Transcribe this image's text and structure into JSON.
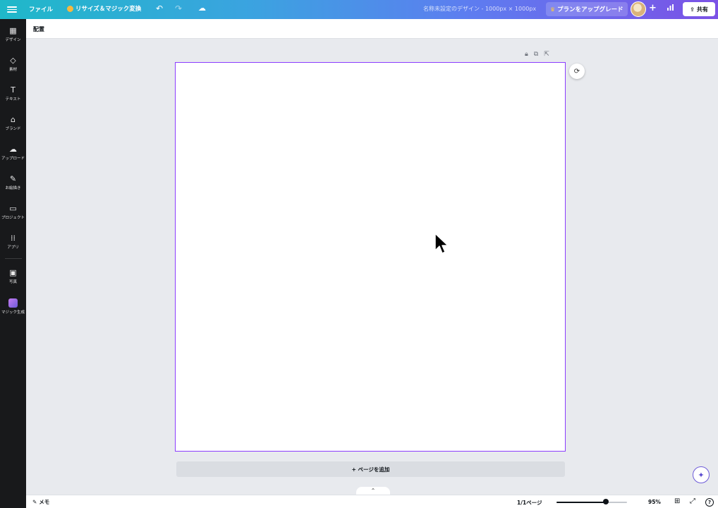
{
  "header": {
    "file_menu": "ファイル",
    "resize_label": "リサイズ＆マジック変換",
    "undo_icon": "undo-icon",
    "redo_icon": "redo-icon",
    "cloud_icon": "cloud-saved-icon",
    "doc_title": "名称未設定のデザイン - 1000px × 1000px",
    "upgrade_label": "プランをアップグレード",
    "share_label": "共有"
  },
  "sidebar": {
    "items": [
      {
        "label": "デザイン",
        "icon": "layout-icon",
        "glyph": "▦"
      },
      {
        "label": "素材",
        "icon": "elements-icon",
        "glyph": "◇"
      },
      {
        "label": "テキスト",
        "icon": "text-icon",
        "glyph": "T"
      },
      {
        "label": "ブランド",
        "icon": "brand-icon",
        "glyph": "⌂"
      },
      {
        "label": "アップロード",
        "icon": "upload-icon",
        "glyph": "☁"
      },
      {
        "label": "お絵描き",
        "icon": "draw-icon",
        "glyph": "✎"
      },
      {
        "label": "プロジェクト",
        "icon": "folder-icon",
        "glyph": "▭"
      },
      {
        "label": "アプリ",
        "icon": "apps-icon",
        "glyph": "⁞⁞"
      },
      {
        "label": "写真",
        "icon": "photo-icon",
        "glyph": "▣"
      },
      {
        "label": "マジック生成",
        "icon": "magic-media-icon",
        "glyph": ""
      }
    ]
  },
  "context_bar": {
    "arrange_label": "配置"
  },
  "canvas": {
    "add_page_label": "+ ページを追加",
    "selection_color": "#8b3dff"
  },
  "footer": {
    "notes_label": "メモ",
    "page_indicator": "1/1ページ",
    "zoom_level": "95%",
    "zoom_fraction": 0.7,
    "help_label": "?"
  },
  "colors": {
    "header_gradient_start": "#1fb8c9",
    "header_gradient_end": "#7b52e6",
    "sidebar_bg": "#18191b",
    "accent": "#8b3dff"
  }
}
